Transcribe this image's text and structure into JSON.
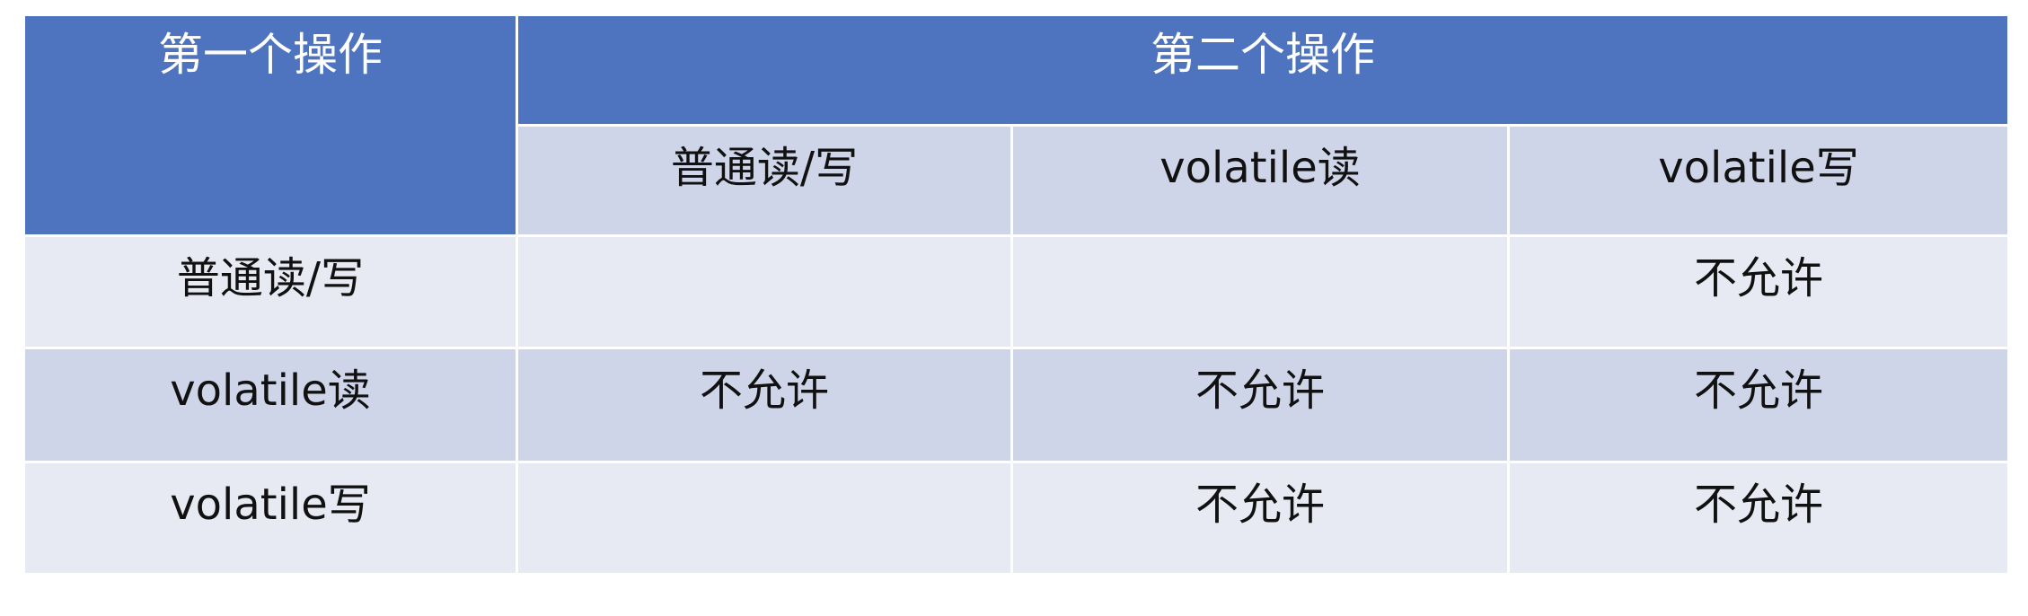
{
  "header": {
    "first_operation": "第一个操作",
    "second_operation": "第二个操作",
    "sub_columns": [
      "普通读/写",
      "volatile读",
      "volatile写"
    ]
  },
  "rows": [
    {
      "label": "普通读/写",
      "cells": [
        "",
        "",
        "不允许"
      ]
    },
    {
      "label": "volatile读",
      "cells": [
        "不允许",
        "不允许",
        "不允许"
      ]
    },
    {
      "label": "volatile写",
      "cells": [
        "",
        "不允许",
        "不允许"
      ]
    }
  ],
  "colors": {
    "header_bg": "#4e74c0",
    "row_light": "#e8eaf3",
    "row_mid": "#cfd5e8"
  }
}
